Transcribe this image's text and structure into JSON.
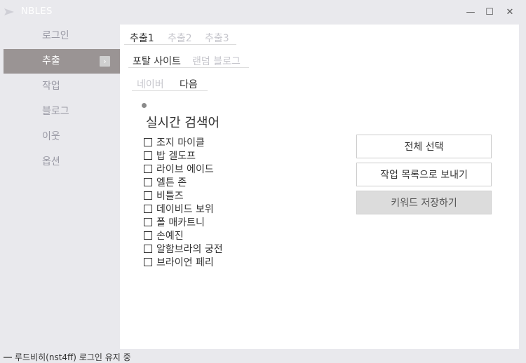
{
  "app": {
    "title": "NBLES",
    "window_controls": {
      "minimize": "—",
      "maximize": "☐",
      "close": "✕"
    }
  },
  "sidebar": {
    "items": [
      {
        "label": "로그인",
        "active": false
      },
      {
        "label": "추출",
        "active": true,
        "indicator": "›"
      },
      {
        "label": "작업",
        "active": false
      },
      {
        "label": "블로그",
        "active": false
      },
      {
        "label": "이웃",
        "active": false
      },
      {
        "label": "옵션",
        "active": false
      }
    ]
  },
  "tabs": {
    "extract": [
      "추출1",
      "추출2",
      "추출3"
    ],
    "source": [
      "포탈 사이트",
      "랜덤 블로그"
    ],
    "portal": [
      "네이버",
      "다음"
    ]
  },
  "section": {
    "title": "실시간 검색어"
  },
  "keywords": [
    "조지 마이클",
    "밥 겔도프",
    "라이브 에이드",
    "엘튼 존",
    "비틀즈",
    "데이비드 보위",
    "폴 매카트니",
    "손예진",
    "알함브라의 궁전",
    "브라이언 페리"
  ],
  "actions": {
    "select_all": "전체 선택",
    "send_to_tasks": "작업 목록으로 보내기",
    "save_keywords": "키워드 저장하기"
  },
  "status": {
    "text": "루드비히(nst4ff) 로그인 유지 중"
  },
  "colors": {
    "active_sidebar": "#9a9494",
    "main_bg": "#ffffff",
    "window_bg": "#e9e9ed"
  }
}
